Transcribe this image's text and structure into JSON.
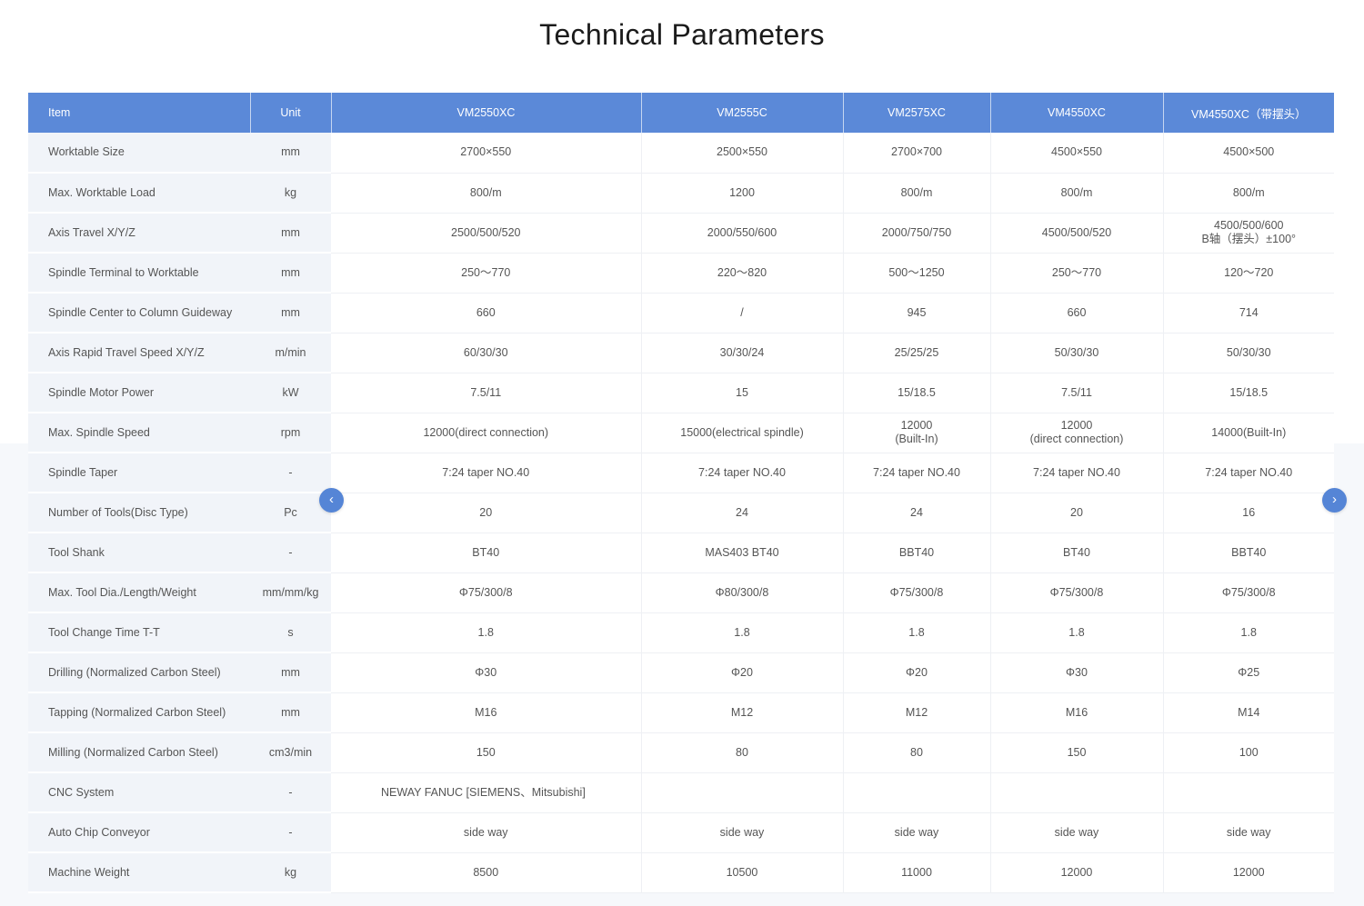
{
  "page": {
    "title": "Technical Parameters"
  },
  "table": {
    "headers": [
      "Item",
      "Unit",
      "VM2550XC",
      "VM2555C",
      "VM2575XC",
      "VM4550XC",
      "VM4550XC（带摆头）"
    ],
    "rows": [
      {
        "item": "Worktable   Size",
        "unit": "mm",
        "values": [
          "2700×550",
          "2500×550",
          "2700×700",
          "4500×550",
          "4500×500"
        ]
      },
      {
        "item": "Max. Worktable Load",
        "unit": "kg",
        "values": [
          "800/m",
          "1200",
          "800/m",
          "800/m",
          "800/m"
        ]
      },
      {
        "item": "Axis Travel X/Y/Z",
        "unit": "mm",
        "values": [
          "2500/500/520",
          "2000/550/600",
          "2000/750/750",
          "4500/500/520",
          "4500/500/600\nB轴（摆头）±100°"
        ]
      },
      {
        "item": "Spindle Terminal to Worktable",
        "unit": "mm",
        "values": [
          "250～770",
          "220～820",
          "500～1250",
          "250～770",
          "120～720"
        ]
      },
      {
        "item": "Spindle Center to Column Guideway",
        "unit": "mm",
        "values": [
          "660",
          "/",
          "945",
          "660",
          "714"
        ]
      },
      {
        "item": "Axis Rapid Travel Speed X/Y/Z",
        "unit": "m/min",
        "values": [
          "60/30/30",
          "30/30/24",
          "25/25/25",
          "50/30/30",
          "50/30/30"
        ]
      },
      {
        "item": "Spindle Motor Power",
        "unit": "kW",
        "values": [
          "7.5/11",
          "15",
          "15/18.5",
          "7.5/11",
          "15/18.5"
        ]
      },
      {
        "item": "Max. Spindle Speed",
        "unit": "rpm",
        "values": [
          "12000(direct connection)",
          "15000(electrical   spindle)",
          "12000\n(Built-In)",
          "12000\n(direct connection)",
          "14000(Built-In)"
        ]
      },
      {
        "item": "Spindle Taper",
        "unit": "-",
        "values": [
          "7:24   taper NO.40",
          "7:24   taper NO.40",
          "7:24   taper NO.40",
          "7:24   taper NO.40",
          "7:24   taper NO.40"
        ]
      },
      {
        "item": "Number of Tools(Disc Type)",
        "unit": "Pc",
        "values": [
          "20",
          "24",
          "24",
          "20",
          "16"
        ]
      },
      {
        "item": "Tool Shank",
        "unit": "-",
        "values": [
          "BT40",
          "MAS403   BT40",
          "BBT40",
          "BT40",
          "BBT40"
        ]
      },
      {
        "item": "Max. Tool Dia./Length/Weight",
        "unit": "mm/mm/kg",
        "values": [
          "Φ75/300/8",
          "Φ80/300/8",
          "Φ75/300/8",
          "Φ75/300/8",
          "Φ75/300/8"
        ]
      },
      {
        "item": "Tool Change Time T-T",
        "unit": "s",
        "values": [
          "1.8",
          "1.8",
          "1.8",
          "1.8",
          "1.8"
        ]
      },
      {
        "item": "Drilling (Normalized    Carbon Steel)",
        "unit": "mm",
        "values": [
          "Φ30",
          "Φ20",
          "Φ20",
          "Φ30",
          "Φ25"
        ]
      },
      {
        "item": "Tapping (Normalized  Carbon   Steel)",
        "unit": "mm",
        "values": [
          "M16",
          "M12",
          "M12",
          "M16",
          "M14"
        ]
      },
      {
        "item": "Milling (Normalized  Carbon  Steel)",
        "unit": "cm3/min",
        "values": [
          "150",
          "80",
          "80",
          "150",
          "100"
        ]
      },
      {
        "item": "CNC System",
        "unit": "-",
        "values": [
          "NEWAY   FANUC [SIEMENS、Mitsubishi]",
          "",
          "",
          "",
          ""
        ]
      },
      {
        "item": "Auto Chip Conveyor",
        "unit": "-",
        "values": [
          "side   way",
          "side way",
          "side   way",
          "side   way",
          "side   way"
        ]
      },
      {
        "item": "Machine Weight",
        "unit": "kg",
        "values": [
          "8500",
          "10500",
          "11000",
          "12000",
          "12000"
        ]
      }
    ]
  },
  "nav": {
    "prev_icon": "‹",
    "next_icon": "›",
    "accent_color": "#5585d6"
  },
  "colors": {
    "header_bg": "#5b89d8",
    "label_bg": "#f1f4f9"
  }
}
